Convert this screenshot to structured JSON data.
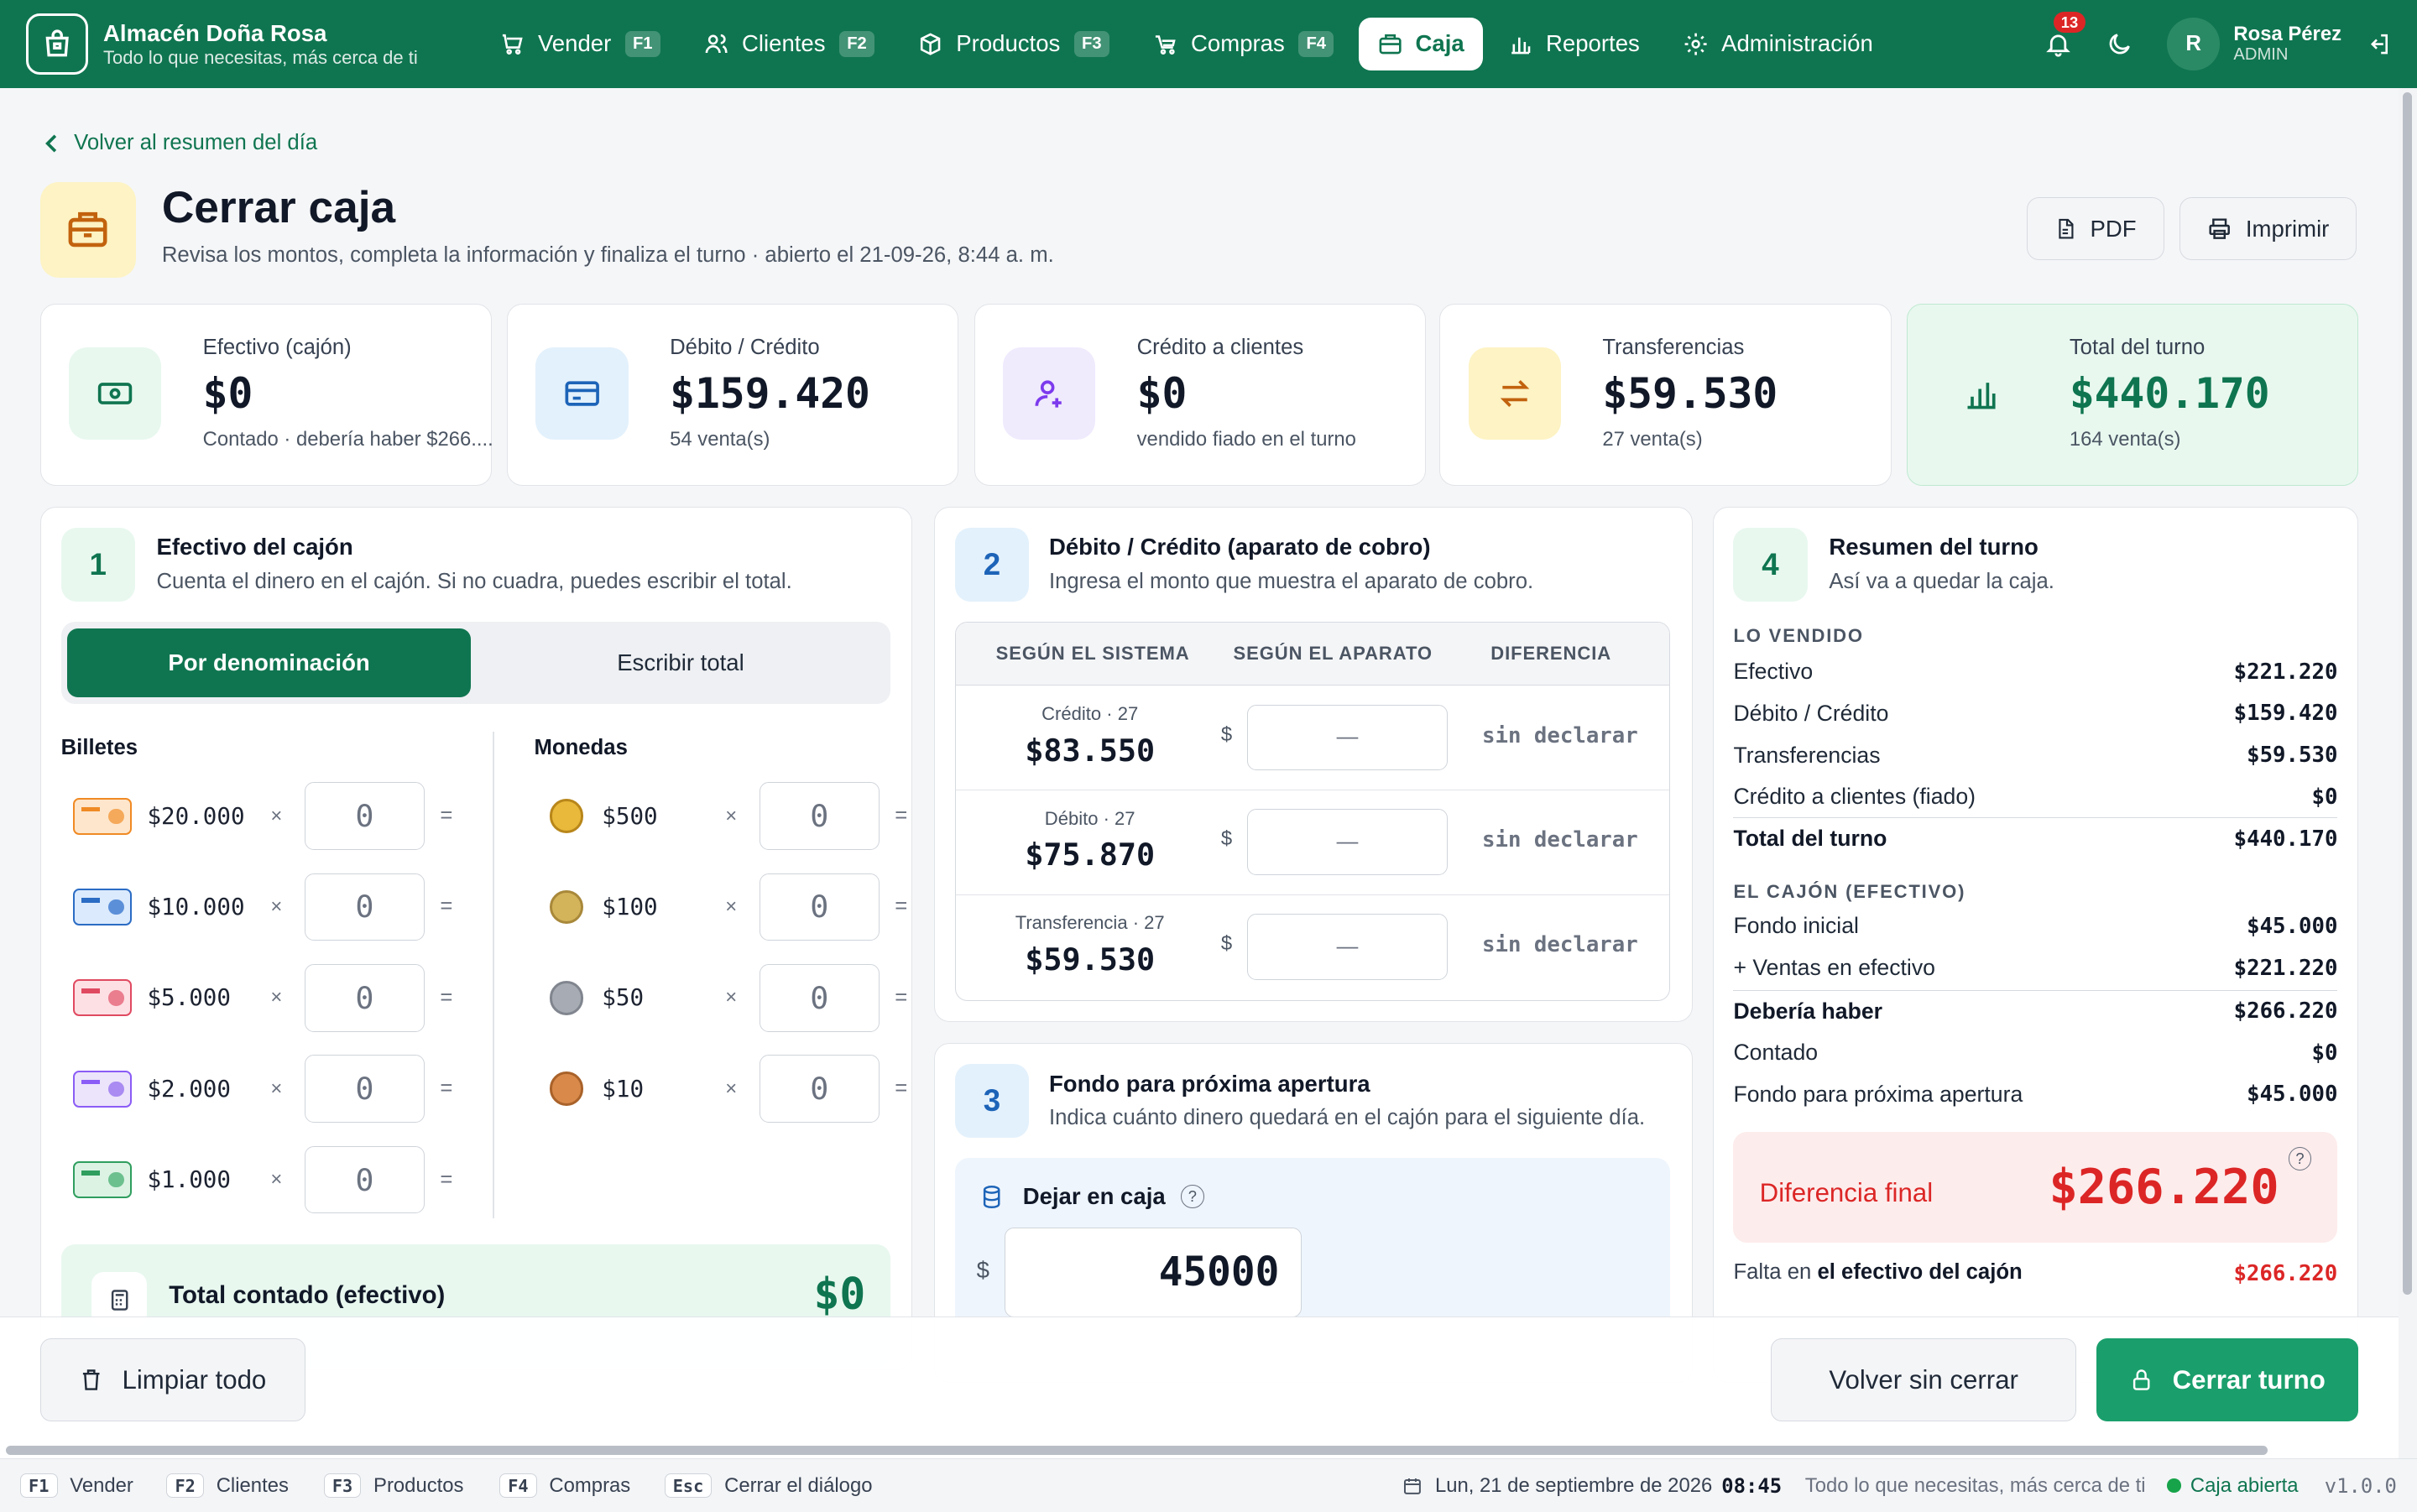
{
  "brand": {
    "name": "Almacén Doña Rosa",
    "tagline": "Todo lo que necesitas, más cerca de ti"
  },
  "nav": [
    {
      "label": "Vender",
      "key": "F1"
    },
    {
      "label": "Clientes",
      "key": "F2"
    },
    {
      "label": "Productos",
      "key": "F3"
    },
    {
      "label": "Compras",
      "key": "F4"
    },
    {
      "label": "Caja",
      "key": ""
    },
    {
      "label": "Reportes",
      "key": ""
    },
    {
      "label": "Administración",
      "key": ""
    }
  ],
  "notifications": {
    "count": "13"
  },
  "user": {
    "initial": "R",
    "name": "Rosa Pérez",
    "role": "ADMIN"
  },
  "back_link": "Volver al resumen del día",
  "page": {
    "title": "Cerrar caja",
    "subtitle": "Revisa los montos, completa la información y finaliza el turno · abierto el 21-09-26, 8:44 a. m."
  },
  "header_buttons": {
    "pdf": "PDF",
    "print": "Imprimir"
  },
  "stats": [
    {
      "label": "Efectivo (cajón)",
      "value": "$0",
      "sub": "Contado · debería haber $266...."
    },
    {
      "label": "Débito / Crédito",
      "value": "$159.420",
      "sub": "54 venta(s)"
    },
    {
      "label": "Crédito a clientes",
      "value": "$0",
      "sub": "vendido fiado en el turno"
    },
    {
      "label": "Transferencias",
      "value": "$59.530",
      "sub": "27 venta(s)"
    },
    {
      "label": "Total del turno",
      "value": "$440.170",
      "sub": "164 venta(s)"
    }
  ],
  "cash": {
    "step": "1",
    "title": "Efectivo del cajón",
    "subtitle": "Cuenta el dinero en el cajón. Si no cuadra, puedes escribir el total.",
    "mode_denomination": "Por denominación",
    "mode_total": "Escribir total",
    "bills_label": "Billetes",
    "coins_label": "Monedas",
    "bills": [
      {
        "amount": "$20.000",
        "count": "0"
      },
      {
        "amount": "$10.000",
        "count": "0"
      },
      {
        "amount": "$5.000",
        "count": "0"
      },
      {
        "amount": "$2.000",
        "count": "0"
      },
      {
        "amount": "$1.000",
        "count": "0"
      }
    ],
    "coins": [
      {
        "amount": "$500",
        "count": "0"
      },
      {
        "amount": "$100",
        "count": "0"
      },
      {
        "amount": "$50",
        "count": "0"
      },
      {
        "amount": "$10",
        "count": "0"
      }
    ],
    "times": "×",
    "equals": "=",
    "total_label": "Total contado (efectivo)",
    "total_value": "$0"
  },
  "debit": {
    "step": "2",
    "title": "Débito / Crédito (aparato de cobro)",
    "subtitle": "Ingresa el monto que muestra el aparato de cobro.",
    "headers": [
      "SEGÚN EL SISTEMA",
      "SEGÚN EL APARATO",
      "DIFERENCIA"
    ],
    "currency": "$",
    "rows": [
      {
        "label": "Crédito · 27",
        "value": "$83.550",
        "input": "—",
        "status": "sin declarar"
      },
      {
        "label": "Débito · 27",
        "value": "$75.870",
        "input": "—",
        "status": "sin declarar"
      },
      {
        "label": "Transferencia · 27",
        "value": "$59.530",
        "input": "—",
        "status": "sin declarar"
      }
    ]
  },
  "fund": {
    "step": "3",
    "title": "Fondo para próxima apertura",
    "subtitle": "Indica cuánto dinero quedará en el cajón para el siguiente día.",
    "field_label": "Dejar en caja",
    "help": "?",
    "currency": "$",
    "value": "45000"
  },
  "summary": {
    "step": "4",
    "title": "Resumen del turno",
    "subtitle": "Así va a quedar la caja.",
    "sold_heading": "LO VENDIDO",
    "sold": [
      {
        "label": "Efectivo",
        "value": "$221.220"
      },
      {
        "label": "Débito / Crédito",
        "value": "$159.420"
      },
      {
        "label": "Transferencias",
        "value": "$59.530"
      },
      {
        "label": "Crédito a clientes (fiado)",
        "value": "$0"
      }
    ],
    "sold_total": {
      "label": "Total del turno",
      "value": "$440.170"
    },
    "drawer_heading": "EL CAJÓN (EFECTIVO)",
    "drawer": [
      {
        "label": "Fondo inicial",
        "value": "$45.000"
      },
      {
        "label": "+ Ventas en efectivo",
        "value": "$221.220"
      }
    ],
    "should_have": {
      "label": "Debería haber",
      "value": "$266.220"
    },
    "counted": {
      "label": "Contado",
      "value": "$0"
    },
    "next_fund": {
      "label": "Fondo para próxima apertura",
      "value": "$45.000"
    },
    "final_diff_label": "Diferencia final",
    "final_diff_value": "$266.220",
    "help": "?",
    "missing_prefix": "Falta en",
    "missing_bold": "el efectivo del cajón",
    "missing_value": "$266.220"
  },
  "actions": {
    "clear": "Limpiar todo",
    "back": "Volver sin cerrar",
    "close": "Cerrar turno"
  },
  "statusbar": {
    "shortcuts": [
      {
        "key": "F1",
        "label": "Vender"
      },
      {
        "key": "F2",
        "label": "Clientes"
      },
      {
        "key": "F3",
        "label": "Productos"
      },
      {
        "key": "F4",
        "label": "Compras"
      },
      {
        "key": "Esc",
        "label": "Cerrar el diálogo"
      }
    ],
    "date": "Lun, 21 de septiembre de 2026",
    "time": "08:45",
    "tagline": "Todo lo que necesitas, más cerca de ti",
    "register_status": "Caja abierta",
    "version": "v1.0.0"
  },
  "colors": {
    "brand": "#0f7550",
    "danger": "#dc2626",
    "success_bg": "#e8f8ef"
  }
}
